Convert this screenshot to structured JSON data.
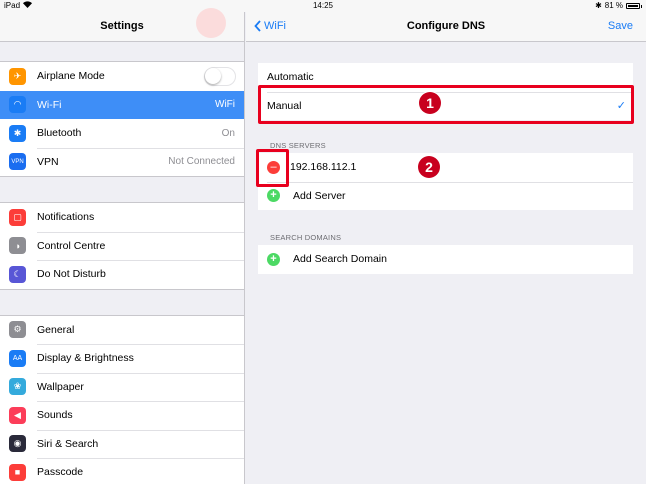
{
  "status_bar": {
    "device": "iPad",
    "time": "14:25",
    "battery": "81 %",
    "battery_level": 0.81
  },
  "left": {
    "title": "Settings",
    "groups": [
      [
        {
          "label": "Airplane Mode",
          "icon": "airplane-icon",
          "color": "#ff9500",
          "toggle": false
        },
        {
          "label": "Wi-Fi",
          "value": "WiFi",
          "icon": "wifi-icon",
          "color": "#1a7cf5",
          "selected": true
        },
        {
          "label": "Bluetooth",
          "value": "On",
          "icon": "bluetooth-icon",
          "color": "#1a7cf5"
        },
        {
          "label": "VPN",
          "value": "Not Connected",
          "icon": "vpn-icon",
          "color": "#1a6df0",
          "icon_text": "VPN"
        }
      ],
      [
        {
          "label": "Notifications",
          "icon": "notifications-icon",
          "color": "#fc3d39"
        },
        {
          "label": "Control Centre",
          "icon": "control-centre-icon",
          "color": "#8e8e93"
        },
        {
          "label": "Do Not Disturb",
          "icon": "moon-icon",
          "color": "#5856d6"
        }
      ],
      [
        {
          "label": "General",
          "icon": "gear-icon",
          "color": "#8e8e93"
        },
        {
          "label": "Display & Brightness",
          "icon": "display-icon",
          "color": "#1a7cf5",
          "icon_text": "AA"
        },
        {
          "label": "Wallpaper",
          "icon": "wallpaper-icon",
          "color": "#34aadc"
        },
        {
          "label": "Sounds",
          "icon": "speaker-icon",
          "color": "#fc3d59"
        },
        {
          "label": "Siri & Search",
          "icon": "siri-icon",
          "color": "#2a2a3a"
        },
        {
          "label": "Passcode",
          "icon": "lock-icon",
          "color": "#fc3d39"
        }
      ]
    ]
  },
  "right": {
    "back_label": "WiFi",
    "title": "Configure DNS",
    "save_label": "Save",
    "mode_options": [
      "Automatic",
      "Manual"
    ],
    "selected_mode": "Manual",
    "dns_section": "DNS SERVERS",
    "dns_servers": [
      "192.168.112.1"
    ],
    "add_server": "Add Server",
    "search_section": "SEARCH DOMAINS",
    "add_search_domain": "Add Search Domain"
  },
  "annotations": {
    "badge1": "1",
    "badge2": "2",
    "color": "#e8001e"
  }
}
